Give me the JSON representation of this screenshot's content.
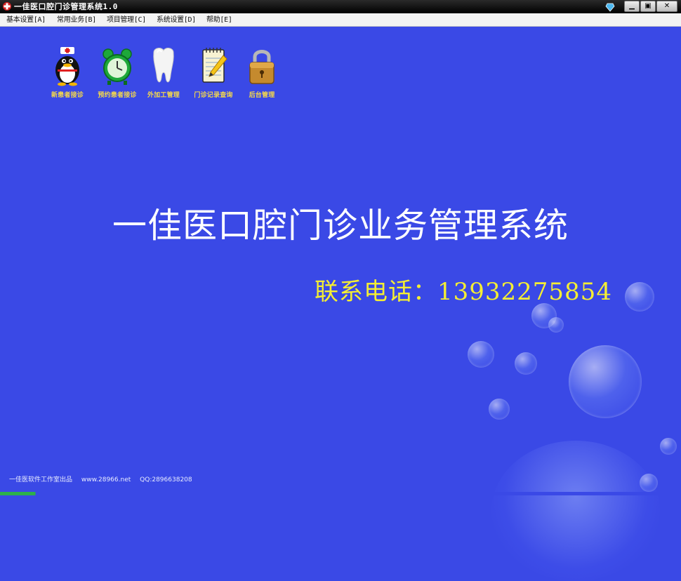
{
  "window": {
    "title": "一佳医口腔门诊管理系统1.0",
    "controls": {
      "minimize": "▁",
      "maximize": "▣",
      "close": "✕"
    }
  },
  "menu": [
    {
      "label": "基本设置[A]"
    },
    {
      "label": "常用业务[B]"
    },
    {
      "label": "项目管理[C]"
    },
    {
      "label": "系统设置[D]"
    },
    {
      "label": "帮助[E]"
    }
  ],
  "launchers": [
    {
      "label": "新患者接诊",
      "icon": "penguin-nurse-icon"
    },
    {
      "label": "预约患者接诊",
      "icon": "alarm-clock-icon"
    },
    {
      "label": "外加工管理",
      "icon": "tooth-icon"
    },
    {
      "label": "门诊记录查询",
      "icon": "notepad-icon"
    },
    {
      "label": "后台管理",
      "icon": "padlock-icon"
    }
  ],
  "main": {
    "headline": "一佳医口腔门诊业务管理系统",
    "phone": "联系电话：13932275854"
  },
  "footer": {
    "maker": "一佳医软件工作室出品",
    "website": "www.28966.net",
    "qq": "QQ:2896638208"
  },
  "colors": {
    "background": "#3a49e6",
    "headline": "#ffffff",
    "phone": "#f4ee33",
    "launcher_label": "#f5d94a"
  }
}
